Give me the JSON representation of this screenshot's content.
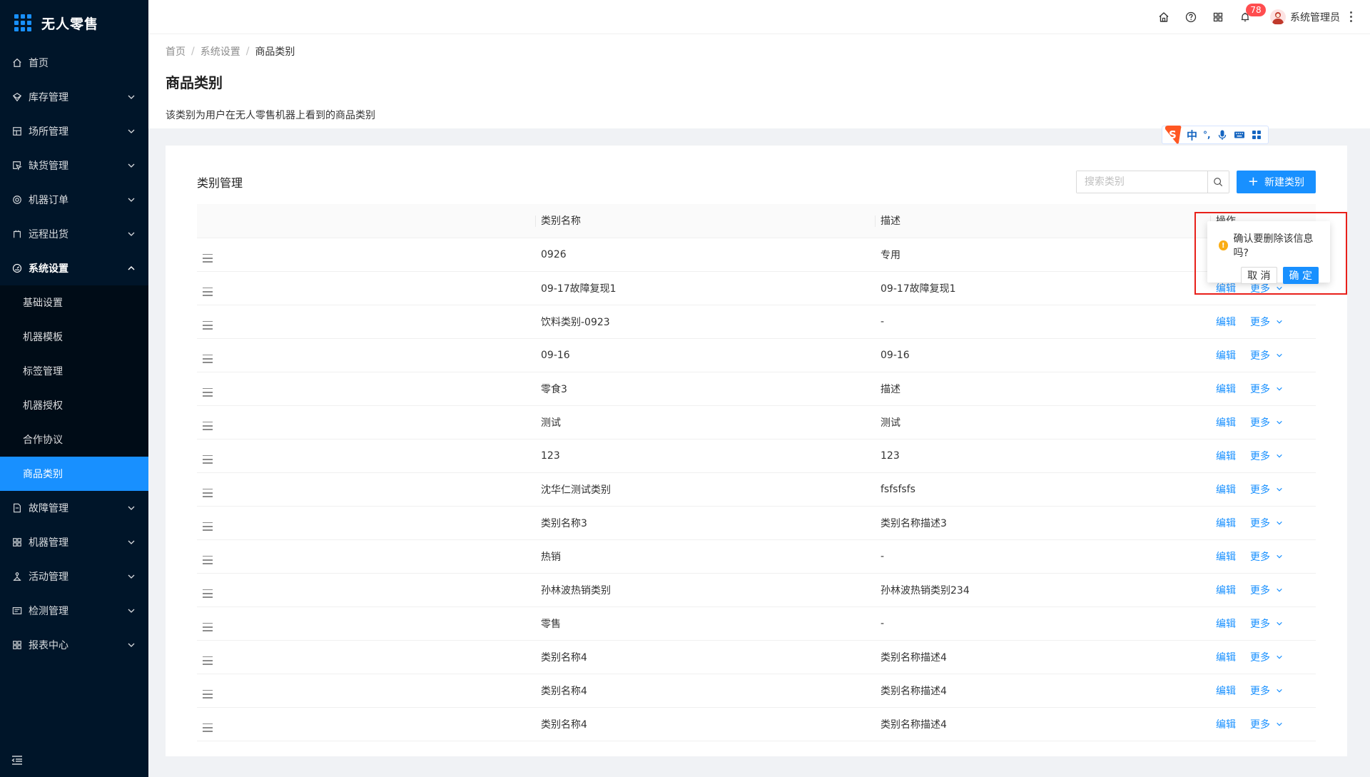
{
  "app": {
    "title": "无人零售",
    "brand_color": "#1890ff",
    "sidebar_bg": "#001529"
  },
  "sidebar": {
    "items": [
      {
        "id": "home",
        "label": "首页",
        "icon": "home-icon",
        "has_children": false
      },
      {
        "id": "inventory",
        "label": "库存管理",
        "icon": "dropbox-icon",
        "has_children": true
      },
      {
        "id": "venue",
        "label": "场所管理",
        "icon": "project-icon",
        "has_children": true
      },
      {
        "id": "shortage",
        "label": "缺货管理",
        "icon": "select-icon",
        "has_children": true
      },
      {
        "id": "orders",
        "label": "机器订单",
        "icon": "gold-icon",
        "has_children": true
      },
      {
        "id": "remote",
        "label": "远程出货",
        "icon": "robot-icon",
        "has_children": true
      },
      {
        "id": "settings",
        "label": "系统设置",
        "icon": "dashboard-icon",
        "has_children": true,
        "open": true
      }
    ],
    "settings_children": [
      {
        "id": "basic",
        "label": "基础设置"
      },
      {
        "id": "template",
        "label": "机器模板"
      },
      {
        "id": "tags",
        "label": "标签管理"
      },
      {
        "id": "auth",
        "label": "机器授权"
      },
      {
        "id": "agreement",
        "label": "合作协议"
      },
      {
        "id": "category",
        "label": "商品类别",
        "active": true
      }
    ],
    "items_after": [
      {
        "id": "fault",
        "label": "故障管理",
        "icon": "file-icon"
      },
      {
        "id": "machine",
        "label": "机器管理",
        "icon": "cluster-icon"
      },
      {
        "id": "activity",
        "label": "活动管理",
        "icon": "deployment-icon"
      },
      {
        "id": "detect",
        "label": "检测管理",
        "icon": "calculator-icon"
      },
      {
        "id": "report",
        "label": "报表中心",
        "icon": "appstore-icon"
      }
    ]
  },
  "header": {
    "notification_count": "78",
    "user_name": "系统管理员"
  },
  "page": {
    "breadcrumb": [
      "首页",
      "系统设置",
      "商品类别"
    ],
    "title": "商品类别",
    "description": "该类别为用户在无人零售机器上看到的商品类别"
  },
  "ime": {
    "mode_label": "中",
    "punct_label": "°,"
  },
  "card": {
    "title": "类别管理",
    "search_placeholder": "搜索类别",
    "new_button_label": "新建类别"
  },
  "table": {
    "columns": [
      "类别名称",
      "描述",
      "操作"
    ],
    "edit_label": "编辑",
    "more_label": "更多",
    "rows": [
      {
        "name": "0926",
        "desc": "专用"
      },
      {
        "name": "09-17故障复现1",
        "desc": "09-17故障复现1"
      },
      {
        "name": "饮料类别-0923",
        "desc": "-"
      },
      {
        "name": "09-16",
        "desc": "09-16"
      },
      {
        "name": "零食3",
        "desc": "描述"
      },
      {
        "name": "测试",
        "desc": "测试"
      },
      {
        "name": "123",
        "desc": "123"
      },
      {
        "name": "沈华仁测试类别",
        "desc": "fsfsfsfs"
      },
      {
        "name": "类别名称3",
        "desc": "类别名称描述3"
      },
      {
        "name": "热销",
        "desc": "-"
      },
      {
        "name": "孙林波热销类别",
        "desc": "孙林波热销类别234"
      },
      {
        "name": "零售",
        "desc": "-"
      },
      {
        "name": "类别名称4",
        "desc": "类别名称描述4"
      },
      {
        "name": "类别名称4",
        "desc": "类别名称描述4"
      },
      {
        "name": "类别名称4",
        "desc": "类别名称描述4"
      }
    ]
  },
  "popconfirm": {
    "message": "确认要删除该信息吗?",
    "cancel_label": "取 消",
    "ok_label": "确 定",
    "warning_color": "#faad14",
    "highlight_color": "#e8201a"
  }
}
